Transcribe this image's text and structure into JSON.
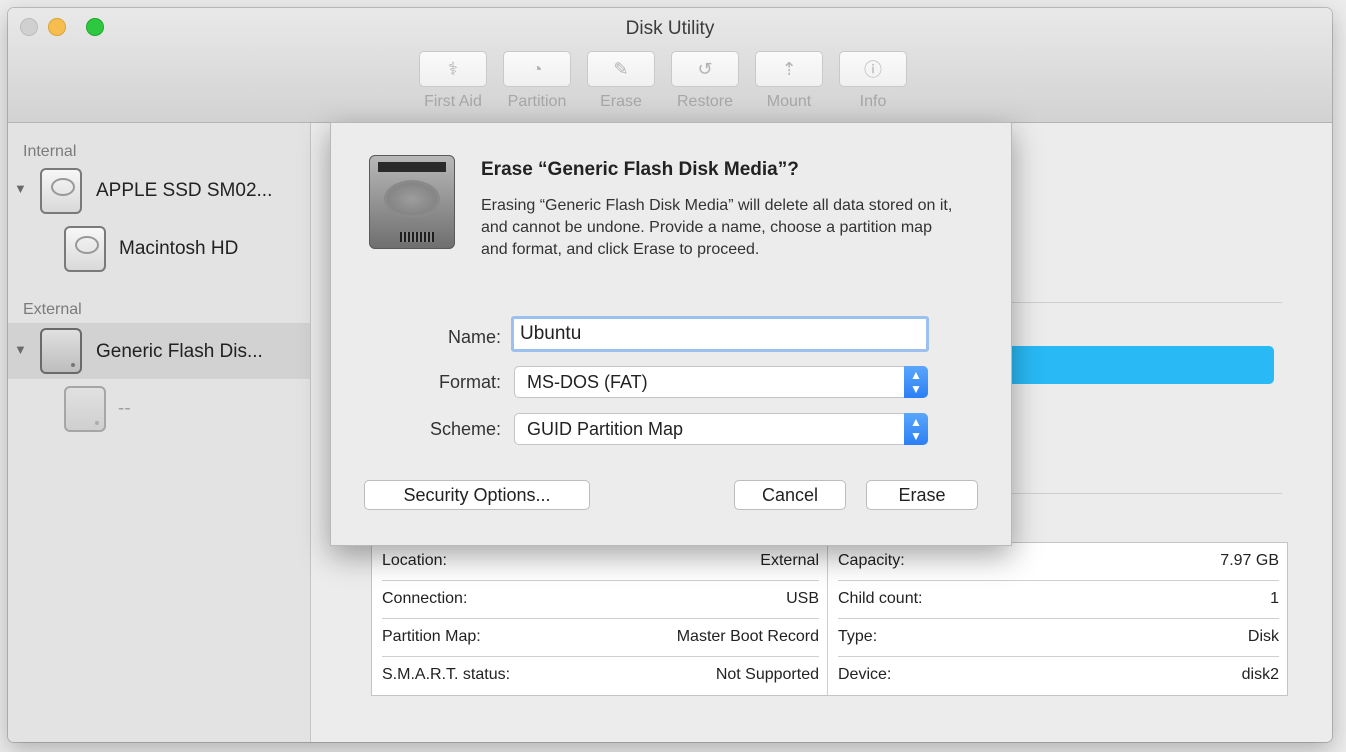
{
  "window": {
    "title": "Disk Utility",
    "toolbar": [
      {
        "label": "First Aid",
        "icon": "stethoscope-icon",
        "glyph": "⚕"
      },
      {
        "label": "Partition",
        "icon": "pie-icon",
        "glyph": "◔"
      },
      {
        "label": "Erase",
        "icon": "erase-icon",
        "glyph": "✎"
      },
      {
        "label": "Restore",
        "icon": "restore-icon",
        "glyph": "↺"
      },
      {
        "label": "Mount",
        "icon": "mount-icon",
        "glyph": "⇡"
      },
      {
        "label": "Info",
        "icon": "info-icon",
        "glyph": "ⓘ"
      }
    ]
  },
  "sidebar": {
    "internal_header": "Internal",
    "external_header": "External",
    "items": [
      {
        "label": "APPLE SSD SM02..."
      },
      {
        "label": "Macintosh HD"
      },
      {
        "label": "Generic Flash Dis..."
      },
      {
        "label": "--"
      }
    ]
  },
  "info": {
    "left": [
      {
        "key": "Location:",
        "value": "External"
      },
      {
        "key": "Connection:",
        "value": "USB"
      },
      {
        "key": "Partition Map:",
        "value": "Master Boot Record"
      },
      {
        "key": "S.M.A.R.T. status:",
        "value": "Not Supported"
      }
    ],
    "right": [
      {
        "key": "Capacity:",
        "value": "7.97 GB"
      },
      {
        "key": "Child count:",
        "value": "1"
      },
      {
        "key": "Type:",
        "value": "Disk"
      },
      {
        "key": "Device:",
        "value": "disk2"
      }
    ]
  },
  "dialog": {
    "title": "Erase “Generic Flash Disk Media”?",
    "message": "Erasing “Generic Flash Disk Media” will delete all data stored on it, and cannot be undone. Provide a name, choose a partition map and format, and click Erase to proceed.",
    "name_label": "Name:",
    "name_value": "Ubuntu",
    "format_label": "Format:",
    "format_value": "MS-DOS (FAT)",
    "scheme_label": "Scheme:",
    "scheme_value": "GUID Partition Map",
    "security_button": "Security Options...",
    "cancel_button": "Cancel",
    "erase_button": "Erase"
  },
  "colors": {
    "usage_bar": "#29b9f4",
    "select_accent": "#2b7ff5",
    "focus_ring": "#9cc1ee"
  }
}
